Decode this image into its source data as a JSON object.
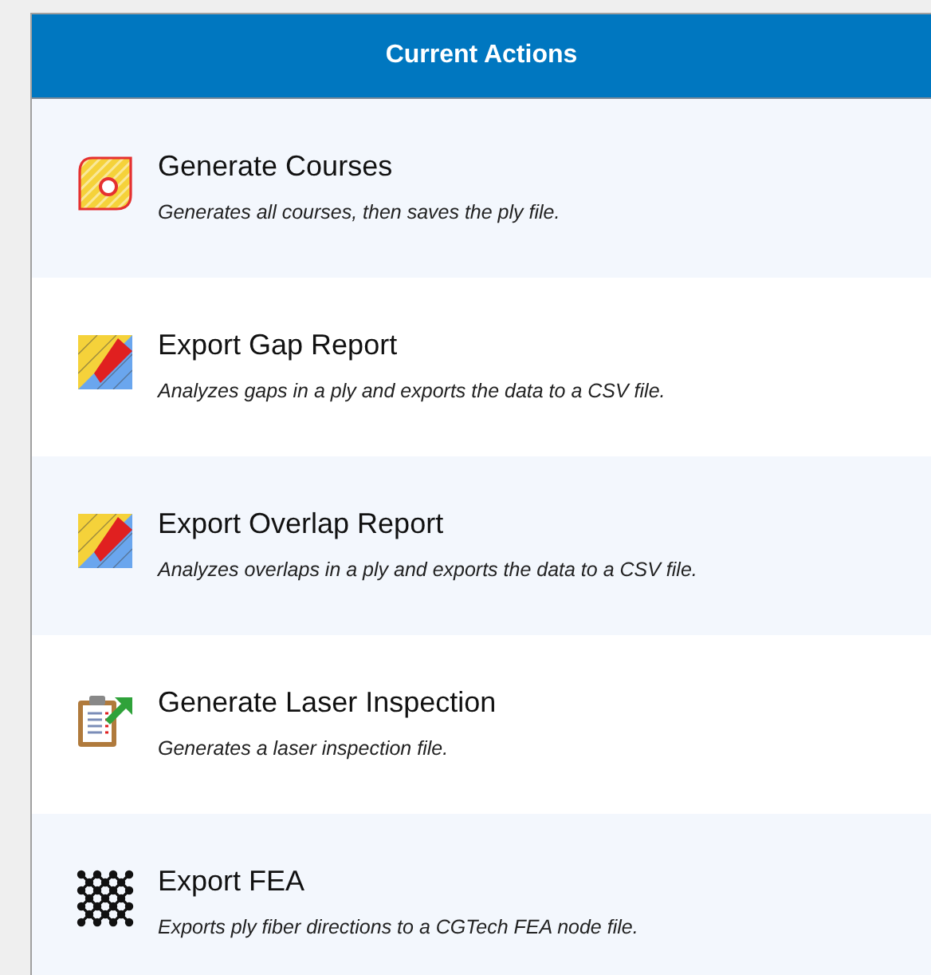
{
  "panel": {
    "title": "Current Actions"
  },
  "actions": [
    {
      "kind": "courses",
      "title": "Generate Courses",
      "description": "Generates all courses, then saves the ply file."
    },
    {
      "kind": "ply-report",
      "title": "Export Gap Report",
      "description": "Analyzes gaps in a ply and exports the data to a CSV file."
    },
    {
      "kind": "ply-report",
      "title": "Export Overlap Report",
      "description": "Analyzes overlaps in a ply and exports the data to a CSV file."
    },
    {
      "kind": "inspection",
      "title": "Generate Laser Inspection",
      "description": "Generates a laser inspection file."
    },
    {
      "kind": "mesh",
      "title": "Export FEA",
      "description": "Exports ply fiber directions to a CGTech FEA node file."
    }
  ]
}
